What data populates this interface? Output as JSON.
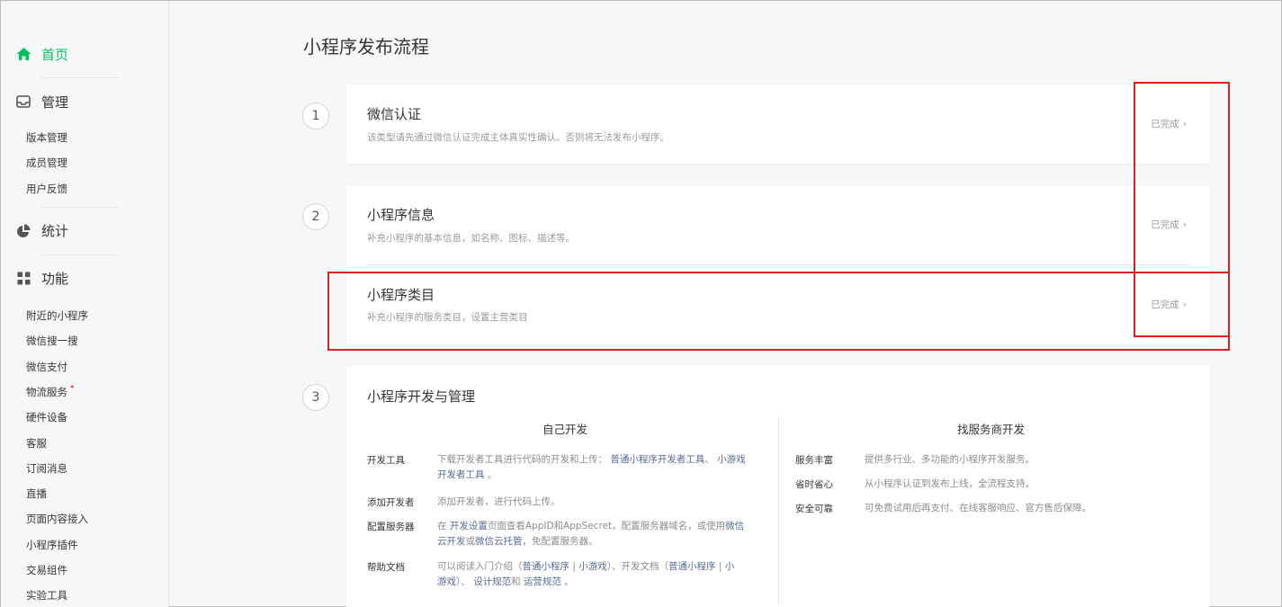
{
  "sidebar": {
    "home": "首页",
    "manage": "管理",
    "manage_items": [
      "版本管理",
      "成员管理",
      "用户反馈"
    ],
    "stats": "统计",
    "features": "功能",
    "feature_items": [
      "附近的小程序",
      "微信搜一搜",
      "微信支付",
      "物流服务",
      "硬件设备",
      "客服",
      "订阅消息",
      "直播",
      "页面内容接入",
      "小程序插件",
      "交易组件",
      "实验工具"
    ],
    "badge_dot": "•"
  },
  "page": {
    "title": "小程序发布流程"
  },
  "steps": [
    {
      "number": "1",
      "rows": [
        {
          "title": "微信认证",
          "desc": "该类型请先通过微信认证完成主体真实性确认。否则将无法发布小程序。",
          "status": "已完成"
        }
      ]
    },
    {
      "number": "2",
      "rows": [
        {
          "title": "小程序信息",
          "desc": "补充小程序的基本信息，如名称、图标、描述等。",
          "status": "已完成"
        },
        {
          "title": "小程序类目",
          "desc": "补充小程序的服务类目，设置主营类目",
          "status": "已完成"
        }
      ]
    },
    {
      "number": "3",
      "title": "小程序开发与管理"
    }
  ],
  "dev": {
    "self": {
      "title": "自己开发",
      "tools_label": "开发工具",
      "tools_text1": "下载开发者工具进行代码的开发和上传：",
      "tools_link1": "普通小程序开发者工具",
      "tools_sep": "、",
      "tools_link2a": "小游戏",
      "tools_link2b": "开发者工具",
      "tools_end": "。",
      "add_label": "添加开发者",
      "add_text": "添加开发者，进行代码上传。",
      "server_label": "配置服务器",
      "server_t1": "在",
      "server_link1": "开发设置",
      "server_t2": "页面查看AppID和AppSecret，配置服务器域名，或使用",
      "server_link2a": "微信",
      "server_link2b": "云开发",
      "server_t3": "或",
      "server_link3": "微信云托管",
      "server_t4": "，免配置服务器。",
      "doc_label": "帮助文档",
      "doc_t1": "可以阅读入门介绍（",
      "doc_link1": "普通小程序",
      "doc_bar": "|",
      "doc_link2": "小游戏",
      "doc_t2": "）、开发文档（",
      "doc_link3": "普通小程序",
      "doc_link4a": "小",
      "doc_link4b": "游戏",
      "doc_t3": "）、",
      "doc_link5": "设计规范",
      "doc_t4": "和",
      "doc_link6": "运营规范",
      "doc_t5": "。"
    },
    "provider": {
      "title": "找服务商开发",
      "items": [
        {
          "label": "服务丰富",
          "text": "提供多行业、多功能的小程序开发服务。"
        },
        {
          "label": "省时省心",
          "text": "从小程序认证到发布上线，全流程支持。"
        },
        {
          "label": "安全可靠",
          "text": "可免费试用后再支付、在线客服响应、官方售后保障。"
        }
      ]
    }
  },
  "colors": {
    "accent": "#07c160",
    "link": "#576b95",
    "highlight": "#e02020"
  }
}
